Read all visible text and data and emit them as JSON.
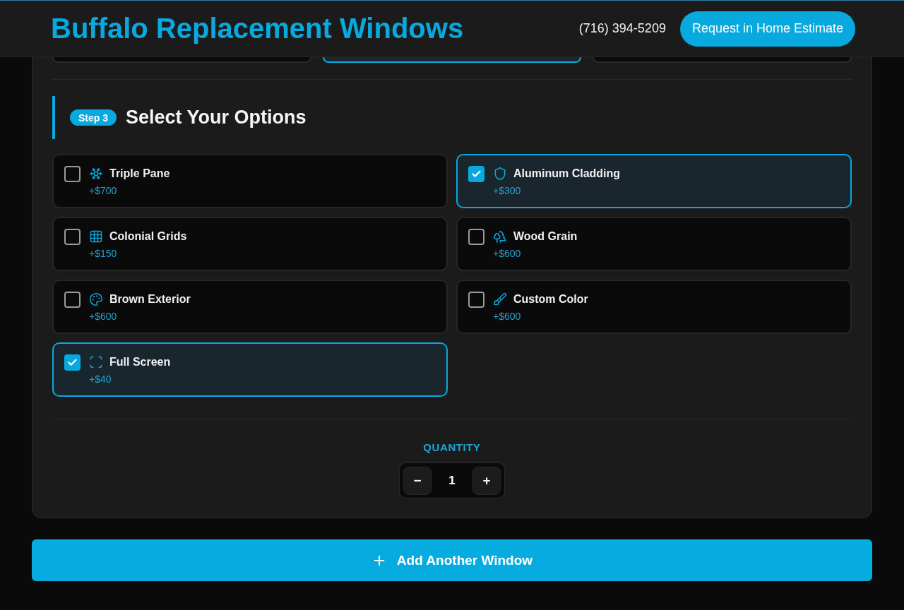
{
  "header": {
    "title": "Buffalo Replacement Windows",
    "phone": "(716) 394-5209",
    "cta_button": "Request in Home Estimate"
  },
  "previous_step": {
    "cards": [
      {
        "selected": false
      },
      {
        "selected": true
      },
      {
        "selected": false
      }
    ]
  },
  "step": {
    "badge": "Step 3",
    "title": "Select Your Options"
  },
  "options": [
    {
      "label": "Triple Pane",
      "price": "+$700",
      "checked": false
    },
    {
      "label": "Aluminum Cladding",
      "price": "+$300",
      "checked": true
    },
    {
      "label": "Colonial Grids",
      "price": "+$150",
      "checked": false
    },
    {
      "label": "Wood Grain",
      "price": "+$600",
      "checked": false
    },
    {
      "label": "Brown Exterior",
      "price": "+$600",
      "checked": false
    },
    {
      "label": "Custom Color",
      "price": "+$600",
      "checked": false
    },
    {
      "label": "Full Screen",
      "price": "+$40",
      "checked": true
    }
  ],
  "quantity": {
    "label": "QUANTITY",
    "decrement": "−",
    "value": "1",
    "increment": "+"
  },
  "add_button": {
    "label": "Add Another Window"
  }
}
